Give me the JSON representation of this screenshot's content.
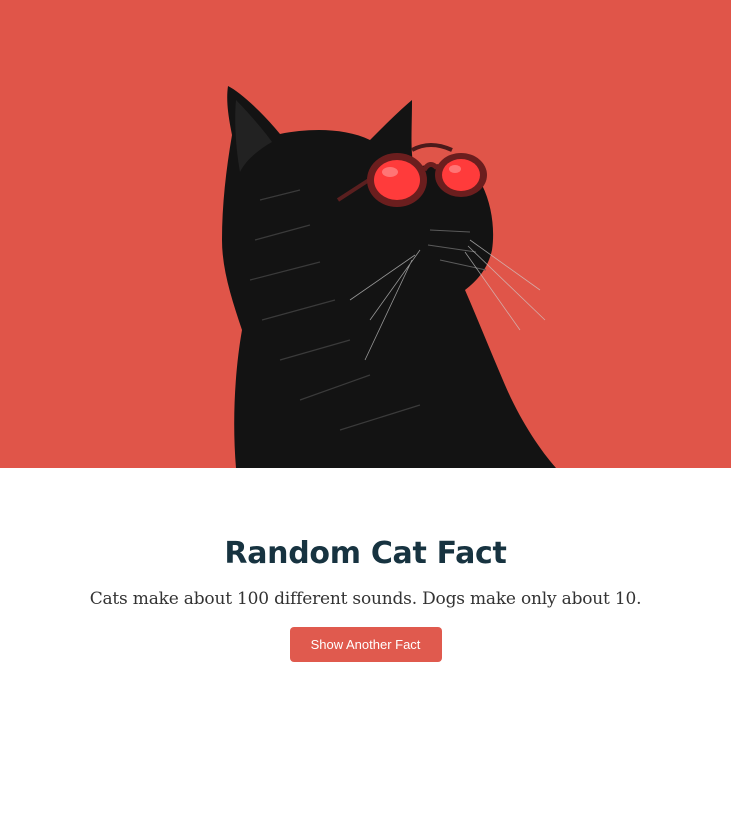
{
  "hero": {
    "background_color": "#e05549",
    "image_subject": "black-cat-with-red-goggles"
  },
  "main": {
    "title": "Random Cat Fact",
    "fact": "Cats make about 100 different sounds. Dogs make only about 10.",
    "button_label": "Show Another Fact"
  },
  "colors": {
    "accent": "#e05a4e",
    "title": "#173340",
    "text": "#333333"
  }
}
